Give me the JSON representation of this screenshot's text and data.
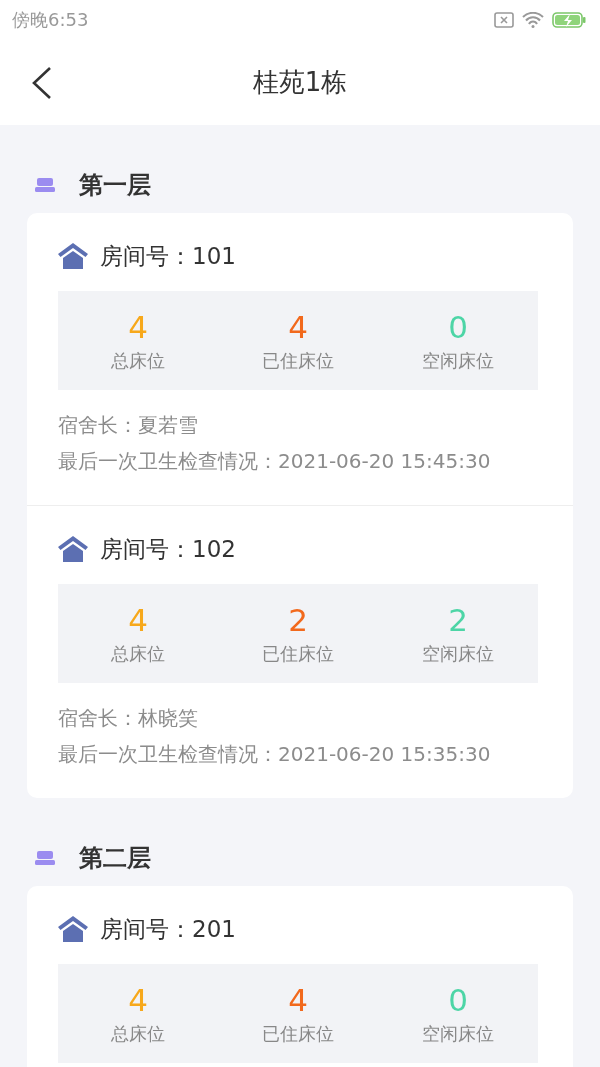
{
  "status_bar": {
    "time": "傍晚6:53"
  },
  "header": {
    "title": "桂苑1栋"
  },
  "floors": [
    {
      "name": "第一层",
      "rooms": [
        {
          "title": "房间号：101",
          "stats": [
            {
              "value": "4",
              "label": "总床位",
              "color": "#f7a81b"
            },
            {
              "value": "4",
              "label": "已住床位",
              "color": "#f2691c"
            },
            {
              "value": "0",
              "label": "空闲床位",
              "color": "#4dd5a6"
            }
          ],
          "leader": "宿舍长：夏若雪",
          "inspection": "最后一次卫生检查情况：2021-06-20 15:45:30"
        },
        {
          "title": "房间号：102",
          "stats": [
            {
              "value": "4",
              "label": "总床位",
              "color": "#f7a81b"
            },
            {
              "value": "2",
              "label": "已住床位",
              "color": "#f2691c"
            },
            {
              "value": "2",
              "label": "空闲床位",
              "color": "#4dd5a6"
            }
          ],
          "leader": "宿舍长：林晓笑",
          "inspection": "最后一次卫生检查情况：2021-06-20 15:35:30"
        }
      ]
    },
    {
      "name": "第二层",
      "rooms": [
        {
          "title": "房间号：201",
          "stats": [
            {
              "value": "4",
              "label": "总床位",
              "color": "#f7a81b"
            },
            {
              "value": "4",
              "label": "已住床位",
              "color": "#f2691c"
            },
            {
              "value": "0",
              "label": "空闲床位",
              "color": "#4dd5a6"
            }
          ]
        }
      ]
    }
  ]
}
